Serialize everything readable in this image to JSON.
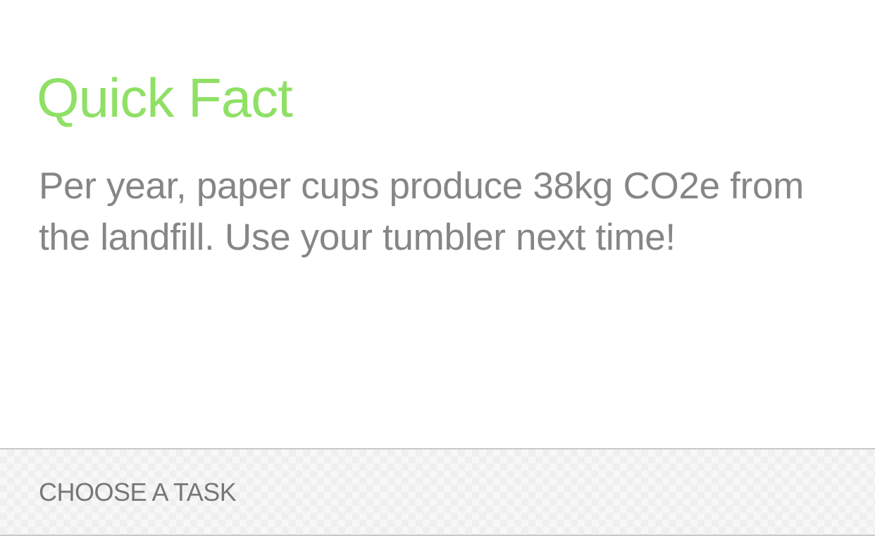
{
  "quick_fact": {
    "title": "Quick Fact",
    "text": "Per year, paper cups produce 38kg CO2e from the landfill. Use your tumbler next time!"
  },
  "task_bar": {
    "label": "CHOOSE A TASK"
  },
  "colors": {
    "title_green": "#8fe065",
    "body_gray": "#868686",
    "task_label_gray": "#777777",
    "bar_border": "#c8c8c8"
  }
}
